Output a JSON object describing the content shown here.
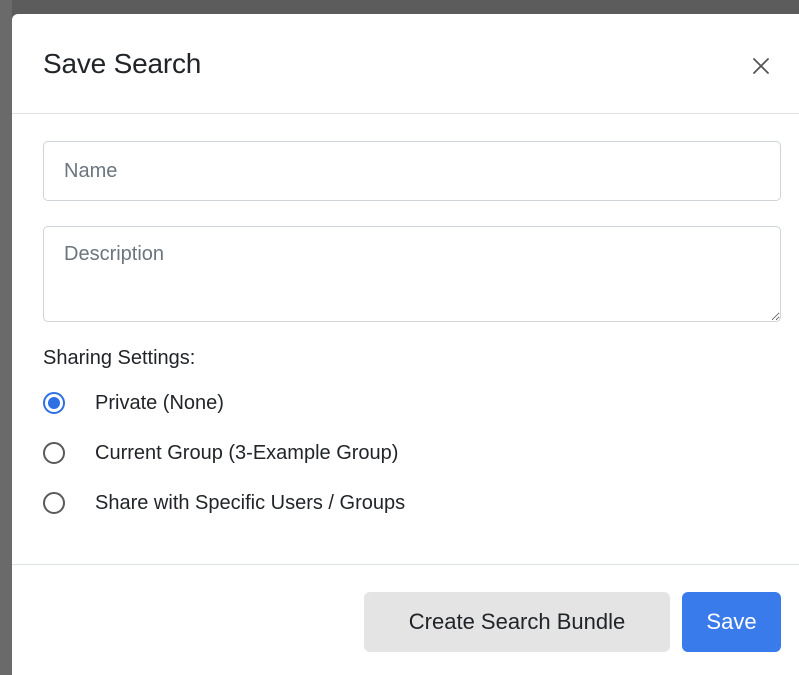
{
  "modal": {
    "title": "Save Search",
    "close_label": "×"
  },
  "form": {
    "name_placeholder": "Name",
    "name_value": "",
    "description_placeholder": "Description",
    "description_value": ""
  },
  "sharing": {
    "label": "Sharing Settings:",
    "options": [
      {
        "label": "Private (None)",
        "checked": true
      },
      {
        "label": "Current Group (3-Example Group)",
        "checked": false
      },
      {
        "label": "Share with Specific Users / Groups",
        "checked": false
      }
    ]
  },
  "footer": {
    "bundle_label": "Create Search Bundle",
    "save_label": "Save"
  },
  "colors": {
    "primary": "#3a7bec",
    "secondary_button": "#e4e4e4",
    "radio_checked": "#2f6fe4"
  },
  "icons": {
    "close": "close-icon"
  }
}
